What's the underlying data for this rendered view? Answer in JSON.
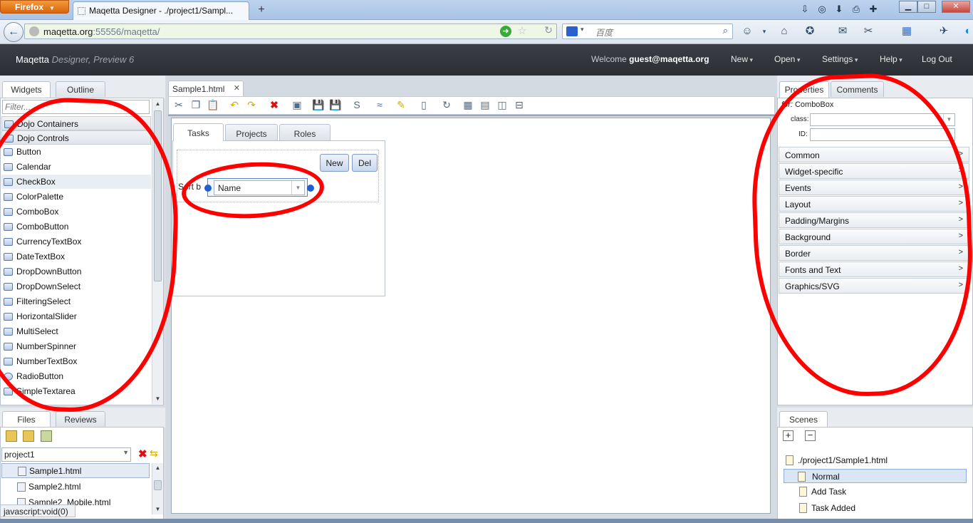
{
  "browser": {
    "menu_label": "Firefox",
    "tab_title": "Maqetta Designer - ./project1/Sampl...",
    "url_host": "maqetta.org",
    "url_rest": ":55556/maqetta/",
    "search_placeholder": "百度",
    "status_text": "javascript:void(0)"
  },
  "app": {
    "name": "Maqetta",
    "subtitle": "Designer, Preview 6",
    "welcome_label": "Welcome",
    "user": "guest@maqetta.org",
    "menu": [
      "New",
      "Open",
      "Settings",
      "Help",
      "Log Out"
    ]
  },
  "left_panel": {
    "tabs": [
      "Widgets",
      "Outline"
    ],
    "filter_placeholder": "Filter...",
    "categories": [
      "Dojo Containers",
      "Dojo Controls"
    ],
    "widgets": [
      "Button",
      "Calendar",
      "CheckBox",
      "ColorPalette",
      "ComboBox",
      "ComboButton",
      "CurrencyTextBox",
      "DateTextBox",
      "DropDownButton",
      "DropDownSelect",
      "FilteringSelect",
      "HorizontalSlider",
      "MultiSelect",
      "NumberSpinner",
      "NumberTextBox",
      "RadioButton",
      "SimpleTextarea"
    ]
  },
  "files_panel": {
    "tabs": [
      "Files",
      "Reviews"
    ],
    "project": "project1",
    "files": [
      "Sample1.html",
      "Sample2.html",
      "Sample2_Mobile.html"
    ]
  },
  "editor": {
    "file_tab": "Sample1.html",
    "canvas_tabs": [
      "Tasks",
      "Projects",
      "Roles"
    ],
    "new_button": "New",
    "del_button": "Del",
    "sort_label": "Sort b",
    "combo_value": "Name"
  },
  "properties_panel": {
    "tabs": [
      "Properties",
      "Comments"
    ],
    "for_label": "for:",
    "for_value": "ComboBox",
    "class_label": "class:",
    "id_label": "ID:",
    "sections": [
      "Common",
      "Widget-specific",
      "Events",
      "Layout",
      "Padding/Margins",
      "Background",
      "Border",
      "Fonts and Text",
      "Graphics/SVG"
    ]
  },
  "scenes_panel": {
    "tab": "Scenes",
    "file": "./project1/Sample1.html",
    "scenes": [
      "Normal",
      "Add Task",
      "Task Added"
    ]
  },
  "colors": {
    "header_bg": "#2f3237",
    "annotation": "#ff0000",
    "selected_scene": "#dbe6f5"
  }
}
